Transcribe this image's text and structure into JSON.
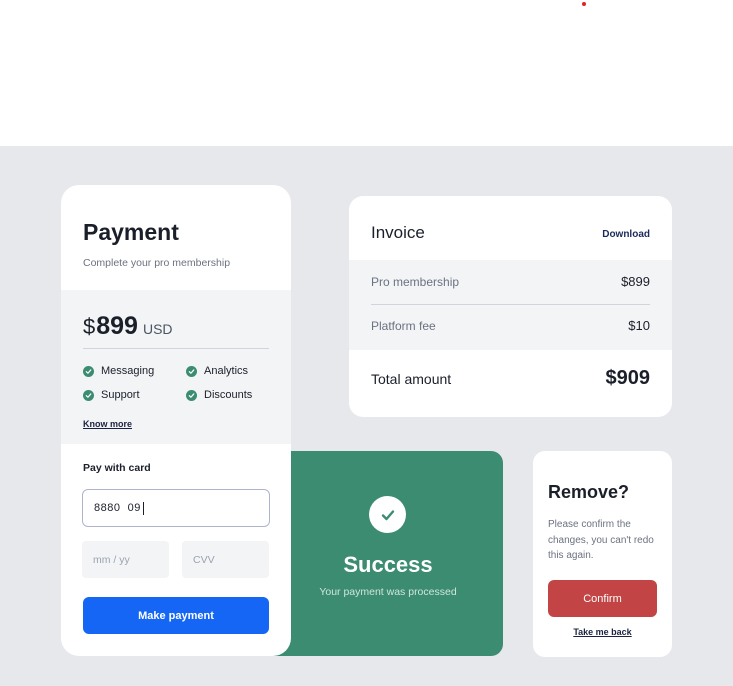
{
  "payment": {
    "title": "Payment",
    "subtitle": "Complete your pro membership",
    "currency_symbol": "$",
    "price": "899",
    "price_unit": "USD",
    "features": [
      "Messaging",
      "Analytics",
      "Support",
      "Discounts"
    ],
    "know_more": "Know more",
    "pay_with_card": "Pay with card",
    "card_number_value": "8880  09",
    "expiry_placeholder": "mm / yy",
    "cvv_placeholder": "CVV",
    "make_payment": "Make payment"
  },
  "success": {
    "title": "Success",
    "subtitle": "Your payment was processed"
  },
  "invoice": {
    "title": "Invoice",
    "download": "Download",
    "items": [
      {
        "label": "Pro membership",
        "value": "$899"
      },
      {
        "label": "Platform fee",
        "value": "$10"
      }
    ],
    "total_label": "Total amount",
    "total_value": "$909"
  },
  "remove": {
    "title": "Remove?",
    "body": "Please confirm the changes, you can't redo this again.",
    "confirm": "Confirm",
    "take_back": "Take me back"
  },
  "colors": {
    "background": "#e7e8eb",
    "primary_blue": "#1566f5",
    "success_green": "#3b8c70",
    "danger_red": "#c24444"
  }
}
